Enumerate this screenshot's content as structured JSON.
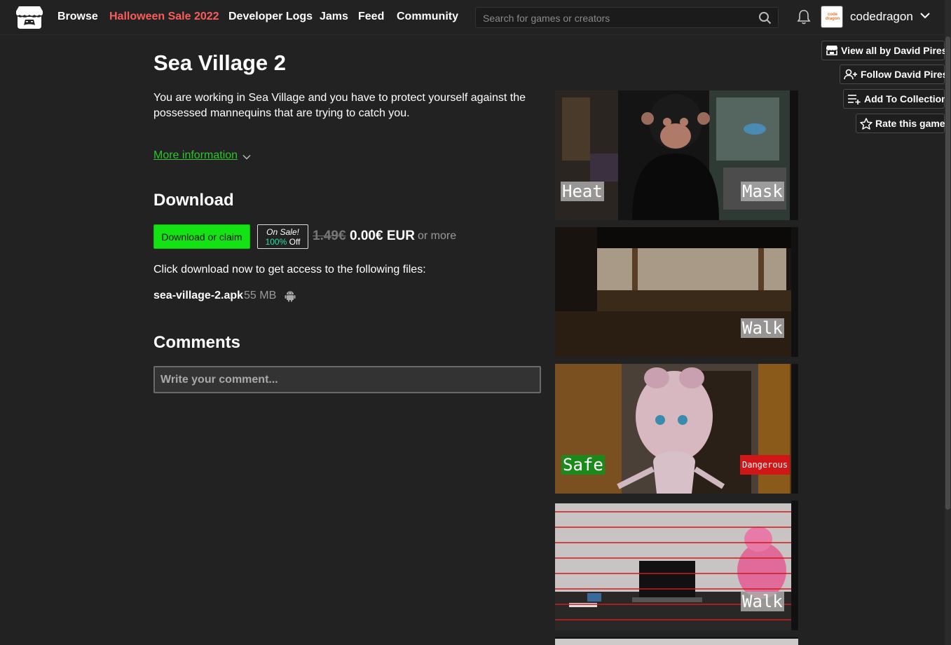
{
  "header": {
    "nav": [
      "Browse",
      "Halloween Sale 2022",
      "Developer Logs",
      "Jams",
      "Feed",
      "Community"
    ],
    "search_placeholder": "Search for games or creators",
    "avatar_text": "code dragon",
    "username": "codedragon"
  },
  "actions": {
    "view_all": "View all by David Pires",
    "follow": "Follow David Pires",
    "add_collection": "Add To Collection",
    "rate": "Rate this game"
  },
  "game": {
    "title": "Sea Village 2",
    "description": "You are working in Sea Village and you have to protect yourself against the possessed mannequins that are trying to catch you.",
    "more_info": "More information"
  },
  "download": {
    "heading": "Download",
    "button": "Download or claim",
    "sale_line1": "On Sale!",
    "sale_pct": "100%",
    "sale_off": "Off",
    "old_price": "1.49€",
    "new_price": "0.00€ EUR",
    "or_more": "or more",
    "click_text": "Click download now to get access to the following files:",
    "file_name": "sea-village-2.apk",
    "file_size": "55 MB"
  },
  "comments": {
    "heading": "Comments",
    "placeholder": "Write your comment..."
  },
  "screenshots": [
    {
      "tags": [
        "Heat",
        "Mask"
      ]
    },
    {
      "tags": [
        "Walk"
      ]
    },
    {
      "tags": [
        "Safe",
        "Dangerous"
      ]
    },
    {
      "tags": [
        "Walk"
      ]
    }
  ],
  "colors": {
    "background": "#222222",
    "sale_link": "#fa5c5c",
    "download_button": "#13e213",
    "link_green": "#2dc52d"
  }
}
